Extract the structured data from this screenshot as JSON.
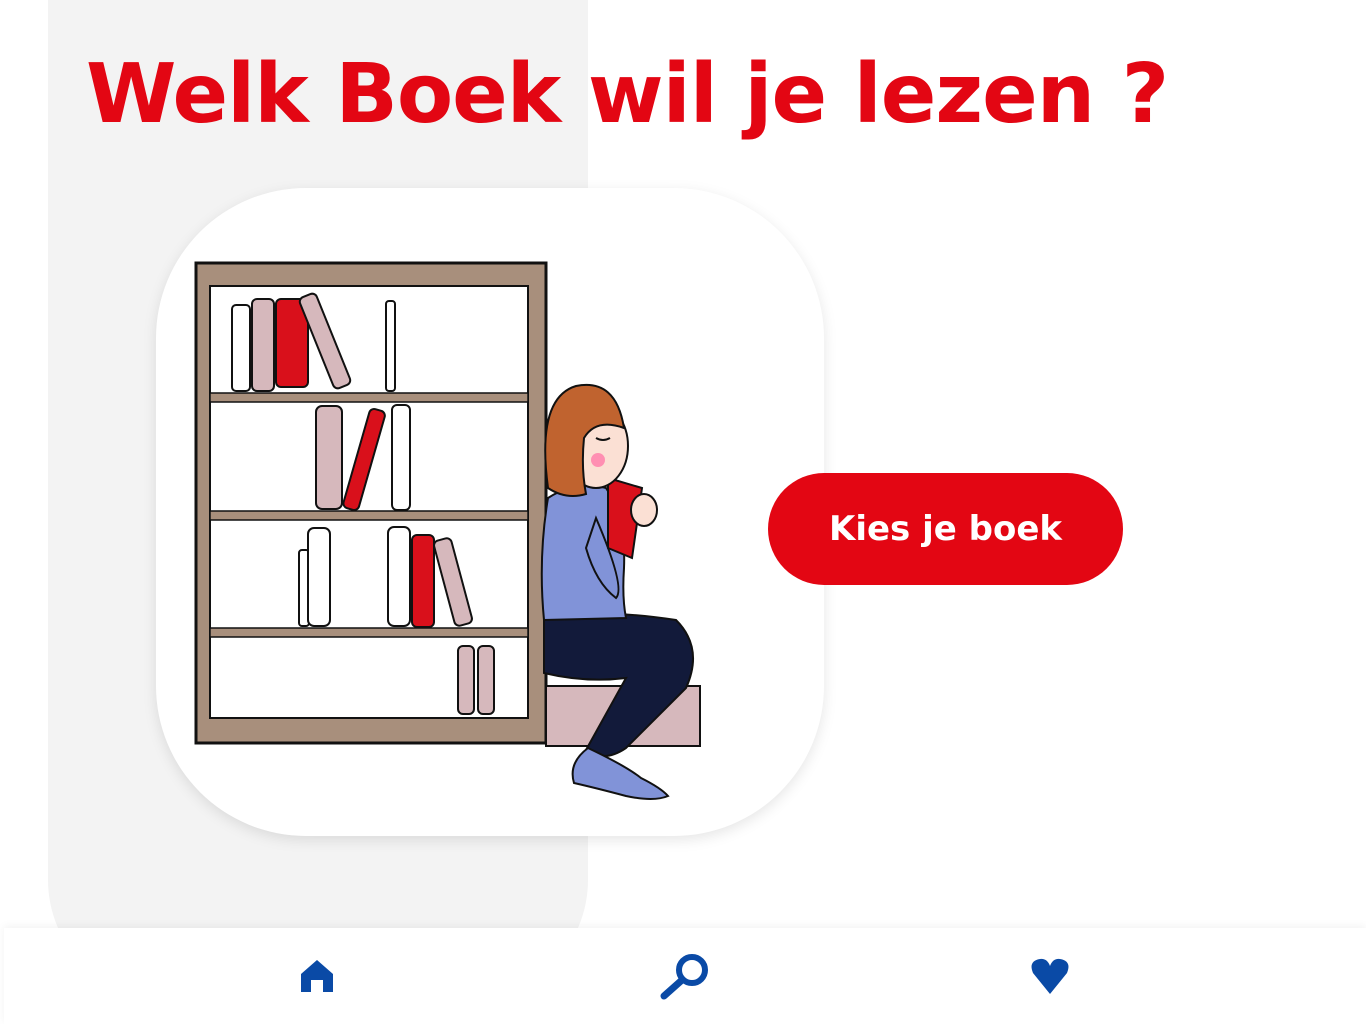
{
  "header": {
    "title": "Welk Boek wil je lezen ?"
  },
  "hero": {
    "cta_label": "Kies je boek"
  },
  "tabbar": {
    "items": [
      {
        "icon": "home-icon",
        "name": "home"
      },
      {
        "icon": "search-icon",
        "name": "search"
      },
      {
        "icon": "heart-icon",
        "name": "favorites"
      }
    ]
  },
  "colors": {
    "accent": "#e30613",
    "nav_icon": "#0a4aa6",
    "panel_bg": "#f3f3f3"
  }
}
